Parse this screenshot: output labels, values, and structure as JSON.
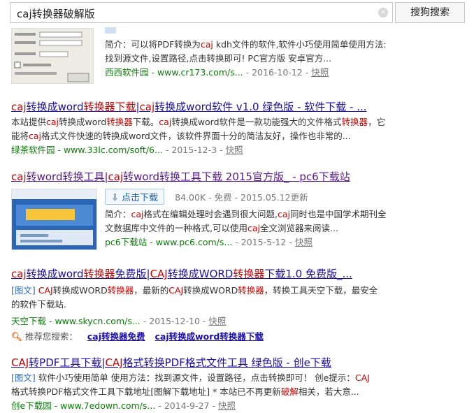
{
  "search": {
    "query": "caj转换器破解版",
    "button": "搜狗搜索",
    "clear_icon": "×"
  },
  "r0": {
    "desc1": "简介：可以将PDF转换为",
    "desc1_kw": "caj",
    "desc1b": " kdh文件的软件,软件小巧使用简单使用方法:",
    "desc2": "找到源文件,设置路径,点击转换即可! PC官方版 安卓官方...",
    "site": "西西软件园 - www.cr173.com/s...",
    "date": "2016-10-12",
    "snap": "快照"
  },
  "r1": {
    "t1": "caj",
    "t2": "转换成word",
    "t3": "转换器下载",
    "t4": "|",
    "t5": "caj",
    "t6": "转换成word软件 v1.0 绿色版 - 软件下载 - ...",
    "d1": "本站提供",
    "d1k": "caj",
    "d1b": "转换成word",
    "d1k2": "转换器",
    "d1c": "下载。",
    "d1k3": "caj",
    "d1d": "转换成word软件是一款功能强大的文件格式",
    "d1k4": "转换器",
    "d1e": "，它",
    "d2": "能将",
    "d2k": "caj",
    "d2b": "格式文件快速的转换成word文件，该软件界面十分的简洁友好，操作也非常的...",
    "site": "绿茶软件园 - www.33lc.com/soft/6...",
    "date": "2015-12-3",
    "snap": "快照"
  },
  "r2": {
    "t1": "caj",
    "t2": "转word转换工具|",
    "t3": "caj",
    "t4": "转word转换工具下载 2015官方版_ - pc6下载站",
    "dl_label": "点击下载",
    "dl_meta": "84.00K - 免费 - 2015.05.12更新",
    "d1": "简介：",
    "d1k": "caj",
    "d1b": "格式在编辑处理时会遇到很大问题,",
    "d1k2": "caj",
    "d1c": "同时也是中国学术期刊全",
    "d2": "文数据库中文件的一种格式,可以使用",
    "d2k": "caj",
    "d2b": "全文浏览器来阅读...",
    "site": "pc6下载站 - www.pc6.com/s...",
    "date": "2015-5-12",
    "snap": "快照"
  },
  "r3": {
    "t1": "caj",
    "t2": "转换成word",
    "t3": "转换器",
    "t4": "免费版|",
    "t5": "CAJ",
    "t6": "转换成WORD",
    "t7": "转换器",
    "t8": "下载1.0 免费版_...",
    "tag": "[图文]",
    "d1k": "CAJ",
    "d1": "转换成WORD",
    "d1k2": "转换器",
    "d1b": "，最新的",
    "d1k3": "CAJ",
    "d1c": "转换成WORD",
    "d1k4": "转换器",
    "d1d": "，转换工具天空下载，最安全",
    "d2": "的软件下载站.",
    "site": "天空下载 - www.skycn.com/s...",
    "date": "2015-12-10",
    "snap": "快照"
  },
  "rec": {
    "label": "推荐您搜索：",
    "link1": "caj转换器免费",
    "link2": "caj转换成word转换器下载"
  },
  "r4": {
    "t1": "CAJ",
    "t2": "转PDF工具下载|",
    "t3": "CAJ",
    "t4": "格式转换PDF格式文件工具 绿色版 - 创e下载",
    "tag": "[图文]",
    "d1": " 软件小巧使用简单 使用方法：找到源文件，设置路径，点击转换即可！ 创e提示：",
    "d1k": "CAJ",
    "d2": "格式转换PDF格式文件工具下载地址[图解下载地址] * 本站已不再更新",
    "d2k": "破解",
    "d2b": "相关，若大意...",
    "site": "创e下载园 - www.7edown.com/s...",
    "date": "2014-9-27",
    "snap": "快照"
  },
  "colors": {
    "link": "#1a0dab",
    "keyword": "#c00",
    "url": "#0a7e07"
  }
}
